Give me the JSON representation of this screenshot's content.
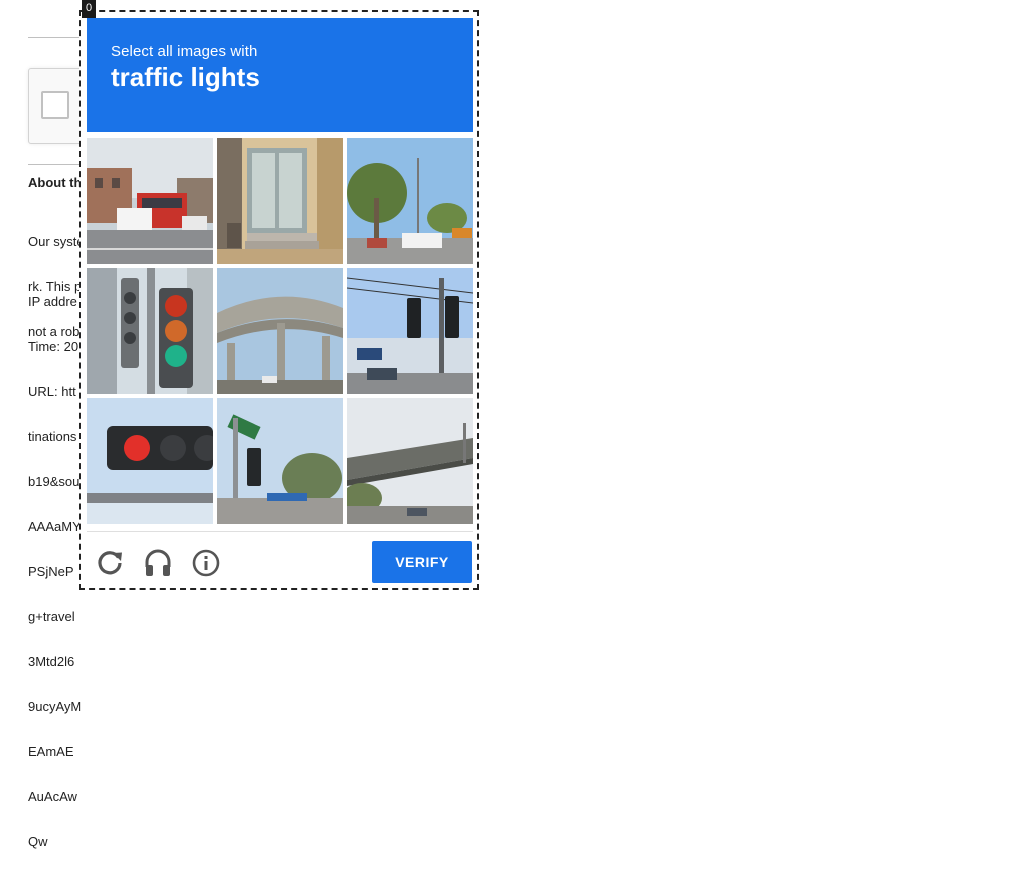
{
  "background_page": {
    "about_label": "About th",
    "paragraph_1_lines": [
      "Our syste",
      "rk. This p",
      "not a rob"
    ],
    "paragraph_2_lines": [
      "IP addre",
      "Time: 20",
      "URL: htt",
      "tinations",
      "b19&sou",
      "AAAaMY",
      "PSjNeP",
      "g+travel",
      "3Mtd2l6",
      "9ucyAyM",
      "EAmAE",
      "AuAcAw",
      "Qw"
    ]
  },
  "challenge": {
    "frame_badge": "0",
    "instruction": "Select all images with",
    "target": "traffic lights",
    "tiles": [
      {
        "index": 0,
        "scene": "street-with-red-bus-and-van",
        "selected": false
      },
      {
        "index": 1,
        "scene": "building-entrance-glass-doors",
        "selected": false
      },
      {
        "index": 2,
        "scene": "trees-road-with-vehicles",
        "selected": false
      },
      {
        "index": 3,
        "scene": "traffic-light-closeup-green",
        "selected": false
      },
      {
        "index": 4,
        "scene": "highway-overpass",
        "selected": false
      },
      {
        "index": 5,
        "scene": "traffic-lights-on-pole-with-wires",
        "selected": false
      },
      {
        "index": 6,
        "scene": "traffic-light-red-horizontal",
        "selected": false
      },
      {
        "index": 7,
        "scene": "street-sign-and-signal-pole",
        "selected": false
      },
      {
        "index": 8,
        "scene": "overpass-bridge-and-road",
        "selected": false
      }
    ],
    "verify_label": "VERIFY",
    "icons": {
      "reload": "reload-icon",
      "audio": "headphones-icon",
      "info": "info-icon"
    },
    "accent_color": "#1a73e8"
  }
}
